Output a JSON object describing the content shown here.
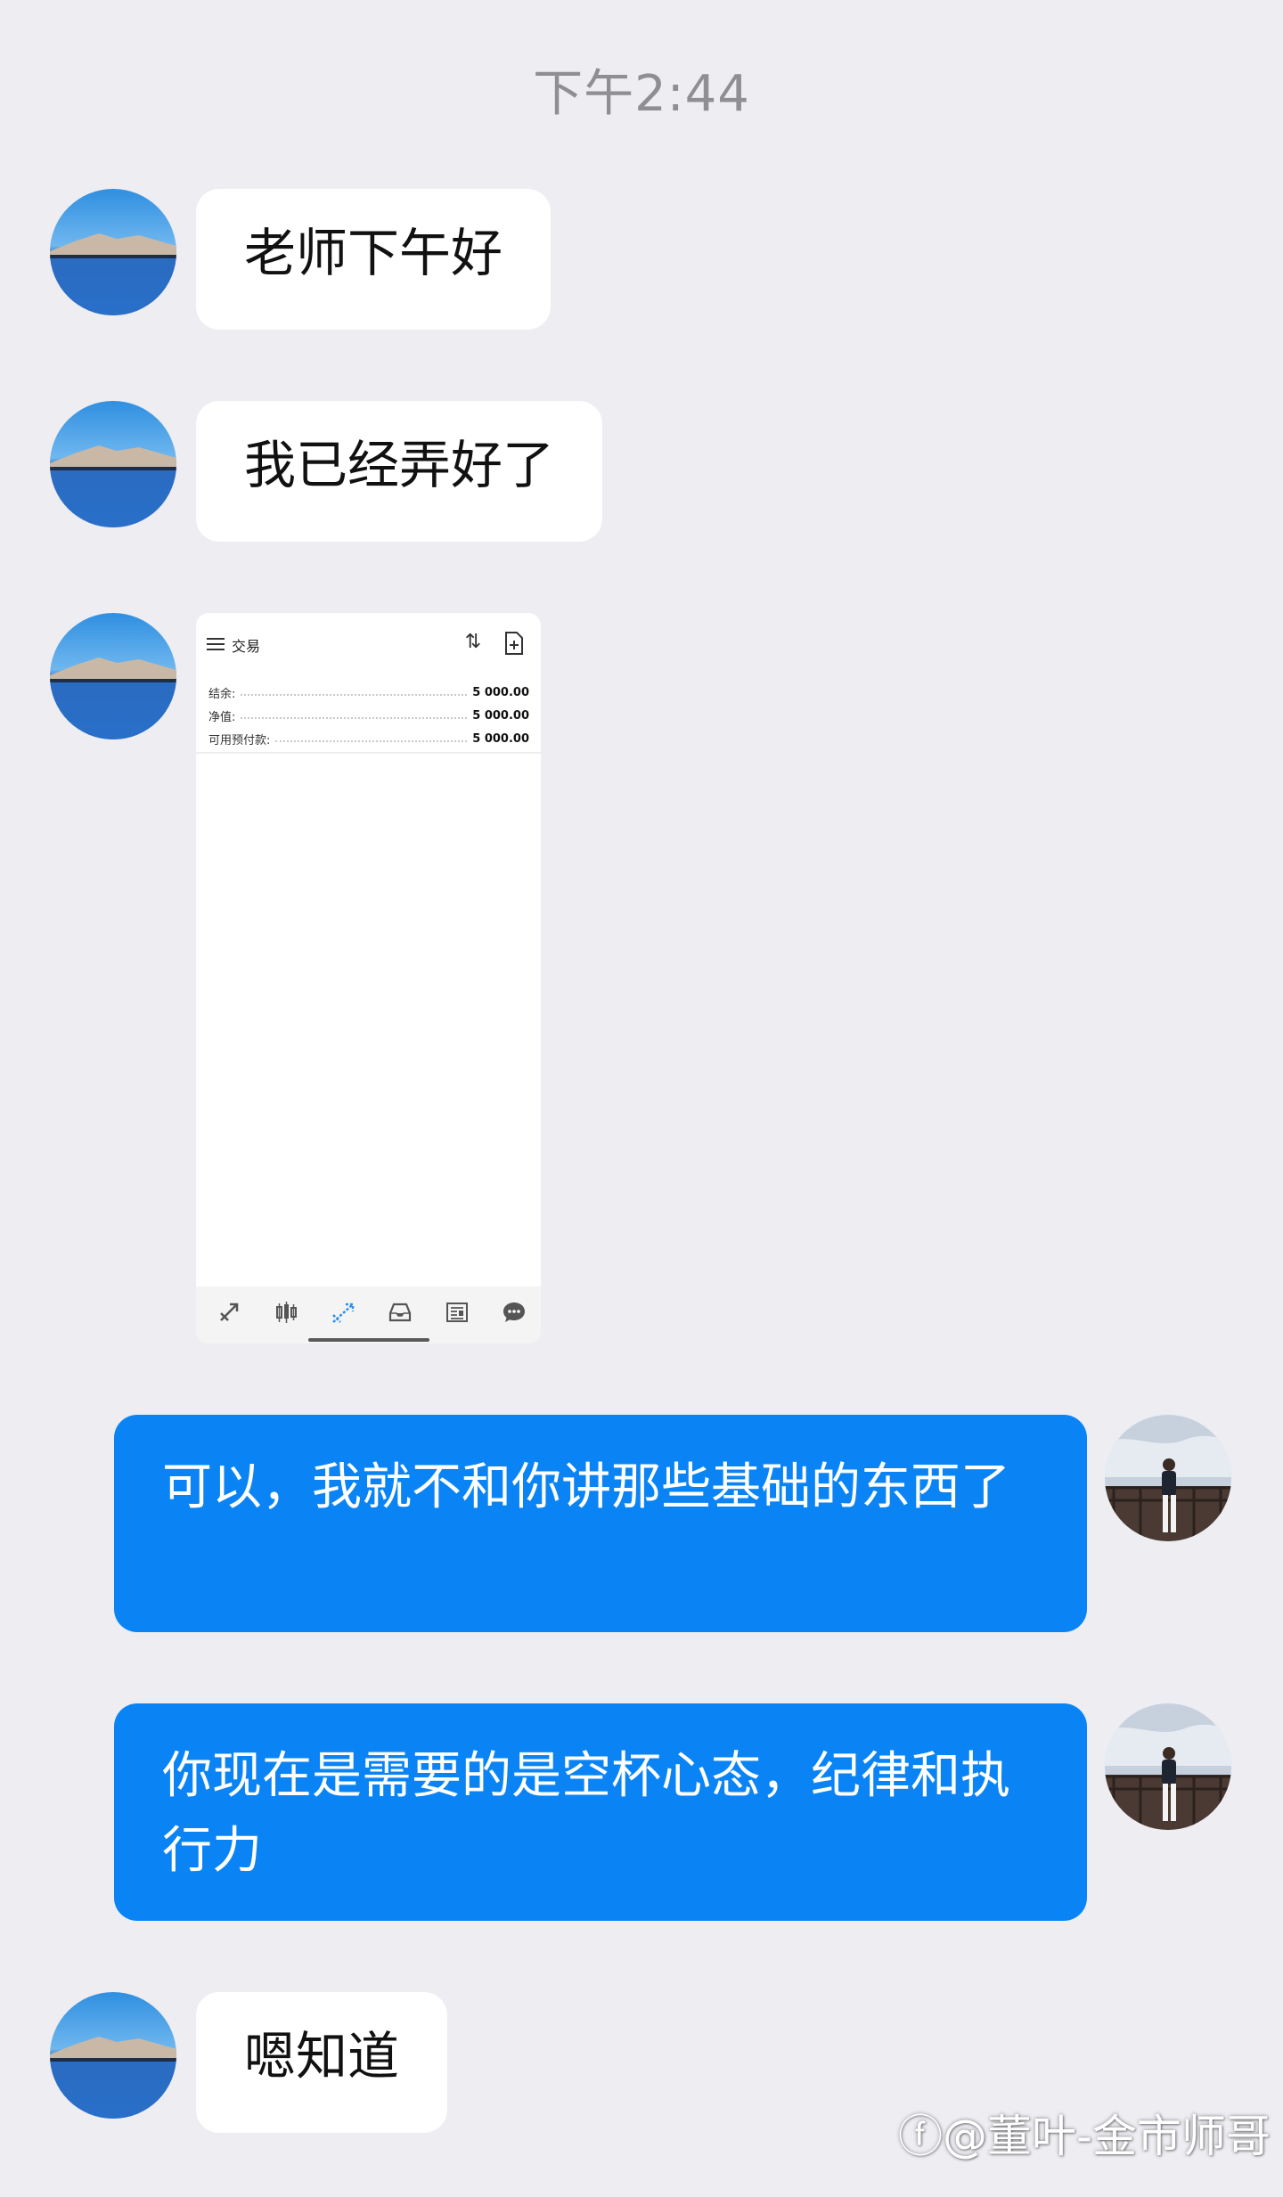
{
  "timestamp": "下午2:44",
  "messages": [
    {
      "side": "left",
      "text": "老师下午好"
    },
    {
      "side": "left",
      "text": "我已经弄好了"
    },
    {
      "side": "left",
      "type": "image"
    },
    {
      "side": "right",
      "text": "可以，我就不和你讲那些基础的东西了"
    },
    {
      "side": "right",
      "text": "你现在是需要的是空杯心态，纪律和执行力"
    },
    {
      "side": "left",
      "text": "嗯知道"
    }
  ],
  "screenshot": {
    "title": "交易",
    "rows": [
      {
        "label": "结余:",
        "value": "5 000.00"
      },
      {
        "label": "净值:",
        "value": "5 000.00"
      },
      {
        "label": "可用预付款:",
        "value": "5 000.00"
      }
    ],
    "tabs": [
      "trade-icon",
      "chart-icon",
      "trade-active-icon",
      "inbox-icon",
      "news-icon",
      "chat-icon"
    ],
    "active_tab_color": "#2f8fe8"
  },
  "watermark": "@董叶-金市师哥",
  "colors": {
    "background": "#ededf2",
    "outgoing_bubble": "#0a84f5",
    "incoming_bubble": "#ffffff"
  }
}
